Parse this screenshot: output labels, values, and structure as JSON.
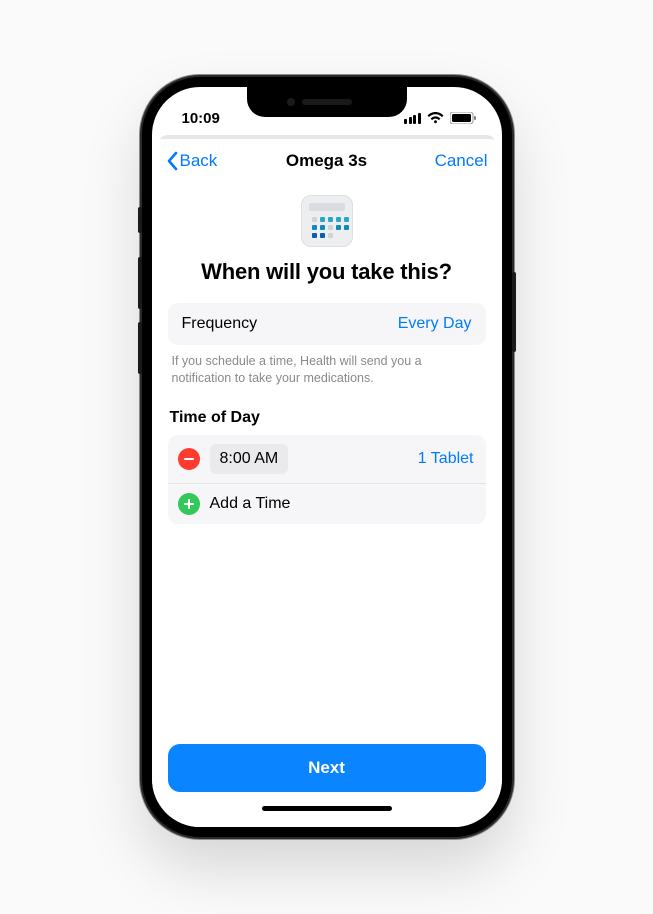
{
  "status": {
    "time": "10:09"
  },
  "nav": {
    "back": "Back",
    "title": "Omega 3s",
    "cancel": "Cancel"
  },
  "heading": "When will you take this?",
  "frequency": {
    "label": "Frequency",
    "value": "Every Day"
  },
  "hint": "If you schedule a time, Health will send you a notification to take your medications.",
  "timeOfDay": {
    "label": "Time of Day",
    "items": [
      {
        "time": "8:00 AM",
        "dose": "1 Tablet"
      }
    ],
    "addLabel": "Add a Time"
  },
  "next": "Next",
  "colors": {
    "accent": "#007aff",
    "primary": "#0a84ff",
    "remove": "#ff3b30",
    "add": "#34c759"
  }
}
